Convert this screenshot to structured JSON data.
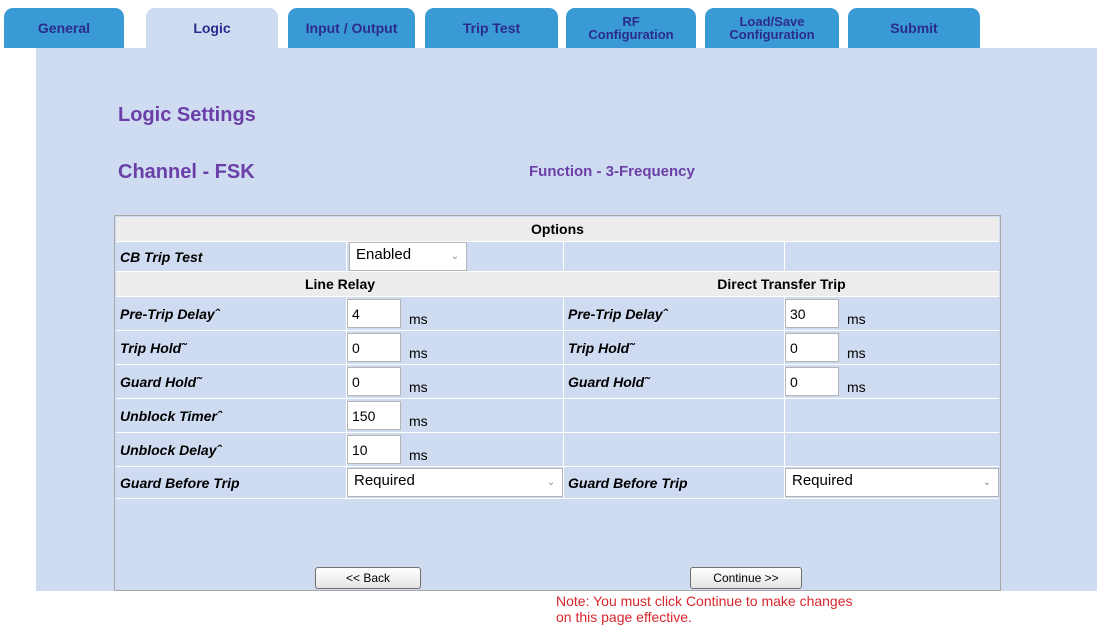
{
  "tabs": [
    {
      "label": "General"
    },
    {
      "label": "Logic"
    },
    {
      "label": "Input / Output"
    },
    {
      "label": "Trip Test"
    },
    {
      "line1": "RF",
      "line2": "Configuration"
    },
    {
      "line1": "Load/Save",
      "line2": "Configuration"
    },
    {
      "label": "Submit"
    }
  ],
  "page": {
    "title": "Logic Settings",
    "channel": "Channel - FSK",
    "function": "Function - 3-Frequency"
  },
  "options": {
    "header": "Options",
    "cb_trip_test": {
      "label": "CB Trip Test",
      "value": "Enabled"
    },
    "line_relay": {
      "header": "Line Relay",
      "pre_trip_delay": {
        "label": "Pre-Trip Delayˆ",
        "value": "4",
        "unit": "ms"
      },
      "trip_hold": {
        "label": "Trip Hold˜",
        "value": "0",
        "unit": "ms"
      },
      "guard_hold": {
        "label": "Guard Hold˜",
        "value": "0",
        "unit": "ms"
      },
      "unblock_timer": {
        "label": "Unblock Timerˆ",
        "value": "150",
        "unit": "ms"
      },
      "unblock_delay": {
        "label": "Unblock Delayˆ",
        "value": "10",
        "unit": "ms"
      },
      "guard_before_trip": {
        "label": "Guard Before Trip",
        "value": "Required"
      }
    },
    "direct_transfer_trip": {
      "header": "Direct Transfer Trip",
      "pre_trip_delay": {
        "label": "Pre-Trip Delayˆ",
        "value": "30",
        "unit": "ms"
      },
      "trip_hold": {
        "label": "Trip Hold˜",
        "value": "0",
        "unit": "ms"
      },
      "guard_hold": {
        "label": "Guard Hold˜",
        "value": "0",
        "unit": "ms"
      },
      "guard_before_trip": {
        "label": "Guard Before Trip",
        "value": "Required"
      }
    }
  },
  "buttons": {
    "back": "<< Back",
    "continue": "Continue >>"
  },
  "note": {
    "line1": "Note: You must click Continue to make changes",
    "line2": "on this page effective."
  },
  "colors": {
    "tab": "#3a9ad6",
    "panel": "#cfdbf0",
    "heading": "#6a3fa8",
    "note": "#d7262b"
  }
}
